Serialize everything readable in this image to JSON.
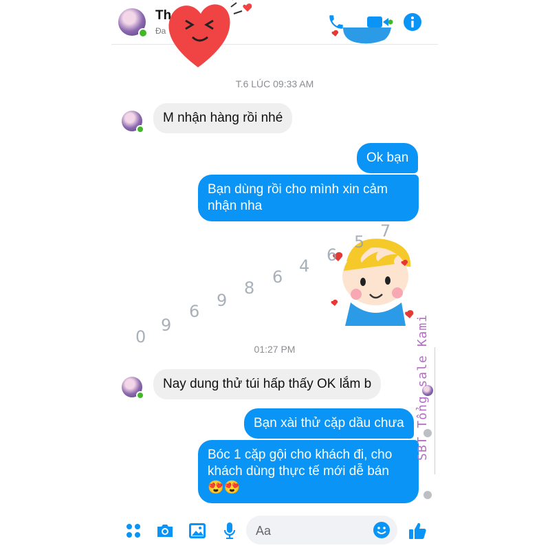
{
  "header": {
    "contact_name": "Th",
    "status": "Đa",
    "icons": [
      "phone-icon",
      "video-call-icon",
      "info-icon"
    ]
  },
  "conversation": {
    "time_separator_1": "T.6 LÚC 09:33 AM",
    "time_separator_2": "01:27 PM",
    "messages": [
      {
        "direction": "incoming",
        "text": "M nhận hàng rồi nhé"
      },
      {
        "direction": "outgoing",
        "text": "Ok bạn"
      },
      {
        "direction": "outgoing",
        "text": "Bạn dùng rồi cho mình xin cảm nhận nha"
      },
      {
        "direction": "incoming",
        "text": "Nay dung thử túi hấp thấy OK lắm b"
      },
      {
        "direction": "outgoing",
        "text": "Bạn xài thử cặp dầu chưa"
      },
      {
        "direction": "outgoing",
        "text": "Bóc 1 cặp gội cho khách đi, cho khách dùng thực tế mới dễ bán",
        "emoji": "😍😍"
      }
    ]
  },
  "watermark": {
    "phone_digits": [
      "0",
      "9",
      "6",
      "9",
      "8",
      "6",
      "4",
      "6",
      "5",
      "7"
    ],
    "side_text": "SBT Tổng sale Kami"
  },
  "composer": {
    "placeholder": "Aa",
    "icons": [
      "apps-icon",
      "camera-icon",
      "gallery-icon",
      "microphone-icon",
      "emoji-icon",
      "like-icon"
    ]
  },
  "colors": {
    "accent": "#0a94f5",
    "incoming_bubble": "#efefef",
    "online": "#42b72a",
    "watermark": "#b26fc4"
  }
}
